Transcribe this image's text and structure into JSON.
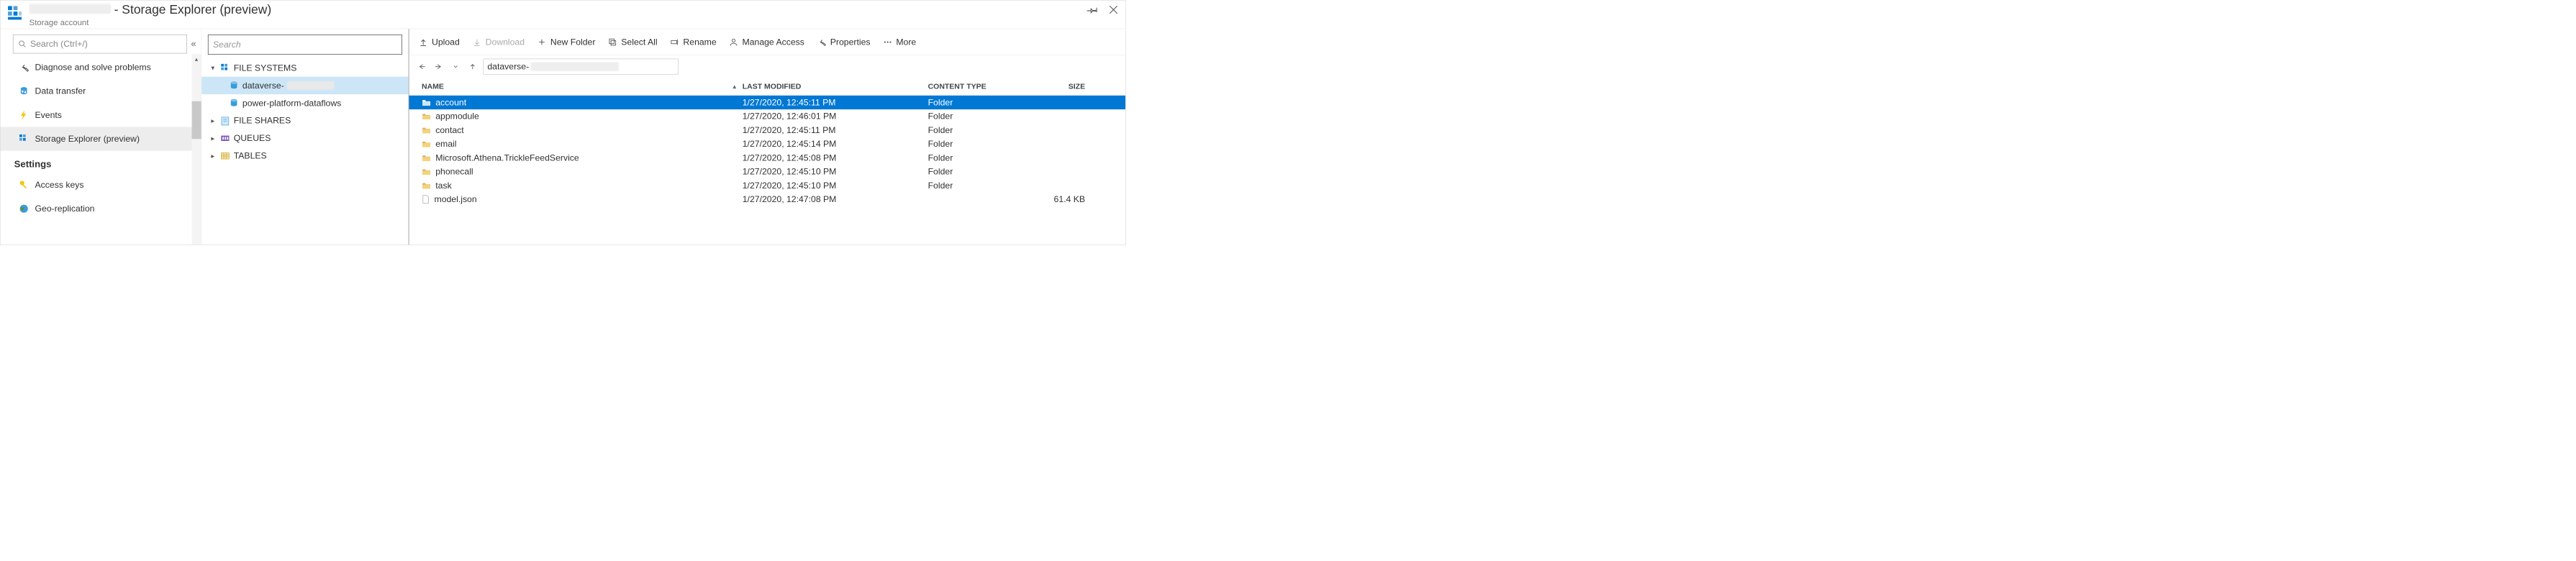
{
  "header": {
    "title_suffix": "- Storage Explorer (preview)",
    "subtitle": "Storage account"
  },
  "sidebar": {
    "search_placeholder": "Search (Ctrl+/)",
    "items": [
      {
        "icon": "wrench",
        "label": "Diagnose and solve problems"
      },
      {
        "icon": "transfer",
        "label": "Data transfer"
      },
      {
        "icon": "bolt",
        "label": "Events"
      },
      {
        "icon": "explorer",
        "label": "Storage Explorer (preview)",
        "selected": true
      }
    ],
    "section_label": "Settings",
    "settings_items": [
      {
        "icon": "key",
        "label": "Access keys"
      },
      {
        "icon": "globe",
        "label": "Geo-replication"
      }
    ]
  },
  "tree": {
    "search_placeholder": "Search",
    "groups": [
      {
        "label": "FILE SYSTEMS",
        "icon": "filesystem",
        "expanded": true,
        "children": [
          {
            "label": "dataverse-",
            "redacted": true,
            "selected": true,
            "icon": "container"
          },
          {
            "label": "power-platform-dataflows",
            "icon": "container"
          }
        ]
      },
      {
        "label": "FILE SHARES",
        "icon": "fileshare"
      },
      {
        "label": "QUEUES",
        "icon": "queue"
      },
      {
        "label": "TABLES",
        "icon": "table"
      }
    ]
  },
  "toolbar": {
    "upload": "Upload",
    "download": "Download",
    "new_folder": "New Folder",
    "select_all": "Select All",
    "rename": "Rename",
    "manage_access": "Manage Access",
    "properties": "Properties",
    "more": "More"
  },
  "breadcrumb": {
    "prefix": "dataverse-"
  },
  "table": {
    "columns": {
      "name": "Name",
      "modified": "Last Modified",
      "type": "Content Type",
      "size": "Size"
    },
    "rows": [
      {
        "kind": "folder",
        "name": "account",
        "modified": "1/27/2020, 12:45:11 PM",
        "type": "Folder",
        "size": "",
        "selected": true
      },
      {
        "kind": "folder",
        "name": "appmodule",
        "modified": "1/27/2020, 12:46:01 PM",
        "type": "Folder",
        "size": ""
      },
      {
        "kind": "folder",
        "name": "contact",
        "modified": "1/27/2020, 12:45:11 PM",
        "type": "Folder",
        "size": ""
      },
      {
        "kind": "folder",
        "name": "email",
        "modified": "1/27/2020, 12:45:14 PM",
        "type": "Folder",
        "size": ""
      },
      {
        "kind": "folder",
        "name": "Microsoft.Athena.TrickleFeedService",
        "modified": "1/27/2020, 12:45:08 PM",
        "type": "Folder",
        "size": ""
      },
      {
        "kind": "folder",
        "name": "phonecall",
        "modified": "1/27/2020, 12:45:10 PM",
        "type": "Folder",
        "size": ""
      },
      {
        "kind": "folder",
        "name": "task",
        "modified": "1/27/2020, 12:45:10 PM",
        "type": "Folder",
        "size": ""
      },
      {
        "kind": "file",
        "name": "model.json",
        "modified": "1/27/2020, 12:47:08 PM",
        "type": "",
        "size": "61.4 KB"
      }
    ]
  }
}
